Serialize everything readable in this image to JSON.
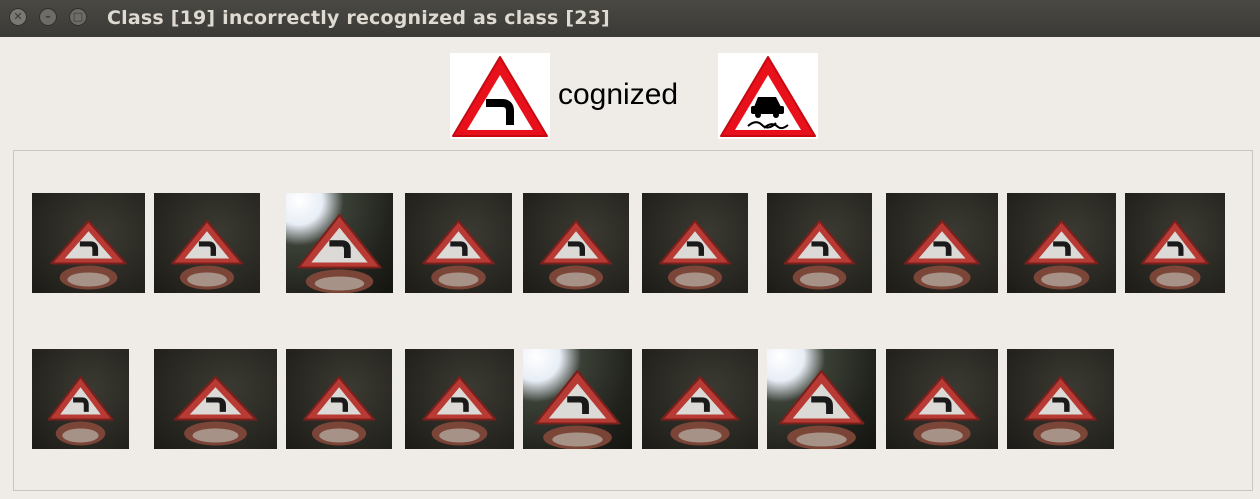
{
  "window": {
    "title": "Class [19] incorrectly recognized as class [23]",
    "buttons": [
      "close",
      "minimize",
      "maximize"
    ]
  },
  "header": {
    "text": "cognized",
    "true_class_icon": "dangerous-curve-left-sign-icon",
    "predicted_class_icon": "slippery-road-sign-icon"
  },
  "samples": {
    "count": 19,
    "icon": "dangerous-curve-left-sign-photo"
  },
  "colors": {
    "sign_red": "#e8101a",
    "window_bg": "#efebe7",
    "titlebar": "#3c3b37"
  }
}
